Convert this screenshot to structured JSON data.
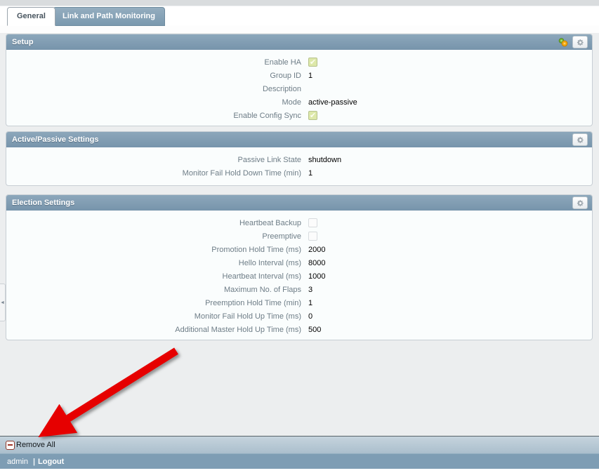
{
  "tabs": [
    {
      "label": "General",
      "active": true
    },
    {
      "label": "Link and Path Monitoring",
      "active": false
    }
  ],
  "sections": [
    {
      "title": "Setup",
      "header_icons": [
        "sync-icon",
        "gear-icon"
      ],
      "fields": [
        {
          "label": "Enable HA",
          "type": "checkbox",
          "checked": true
        },
        {
          "label": "Group ID",
          "type": "text",
          "value": "1"
        },
        {
          "label": "Description",
          "type": "text",
          "value": ""
        },
        {
          "label": "Mode",
          "type": "text",
          "value": "active-passive"
        },
        {
          "label": "Enable Config Sync",
          "type": "checkbox",
          "checked": true
        }
      ]
    },
    {
      "title": "Active/Passive Settings",
      "header_icons": [
        "gear-icon"
      ],
      "fields": [
        {
          "label": "Passive Link State",
          "type": "text",
          "value": "shutdown"
        },
        {
          "label": "Monitor Fail Hold Down Time (min)",
          "type": "text",
          "value": "1"
        }
      ]
    },
    {
      "title": "Election Settings",
      "header_icons": [
        "gear-icon"
      ],
      "fields": [
        {
          "label": "Heartbeat Backup",
          "type": "checkbox",
          "checked": false
        },
        {
          "label": "Preemptive",
          "type": "checkbox",
          "checked": false
        },
        {
          "label": "Promotion Hold Time (ms)",
          "type": "text",
          "value": "2000"
        },
        {
          "label": "Hello Interval (ms)",
          "type": "text",
          "value": "8000"
        },
        {
          "label": "Heartbeat Interval (ms)",
          "type": "text",
          "value": "1000"
        },
        {
          "label": "Maximum No. of Flaps",
          "type": "text",
          "value": "3"
        },
        {
          "label": "Preemption Hold Time (min)",
          "type": "text",
          "value": "1"
        },
        {
          "label": "Monitor Fail Hold Up Time (ms)",
          "type": "text",
          "value": "0"
        },
        {
          "label": "Additional Master Hold Up Time (ms)",
          "type": "text",
          "value": "500"
        }
      ]
    }
  ],
  "footer": {
    "remove_all_label": "Remove All",
    "username": "admin",
    "separator": "|",
    "logout_label": "Logout"
  },
  "annotation": {
    "type": "red-arrow",
    "color": "#e60000"
  },
  "colors": {
    "panel_header": "#7f9db4",
    "tab_inactive": "#7f9db4",
    "page_background": "#eceeef",
    "checkbox_checked": "#dde8a9",
    "remove_bar": "#b3c4d1",
    "admin_bar": "#7e9db4",
    "arrow": "#e60000"
  }
}
